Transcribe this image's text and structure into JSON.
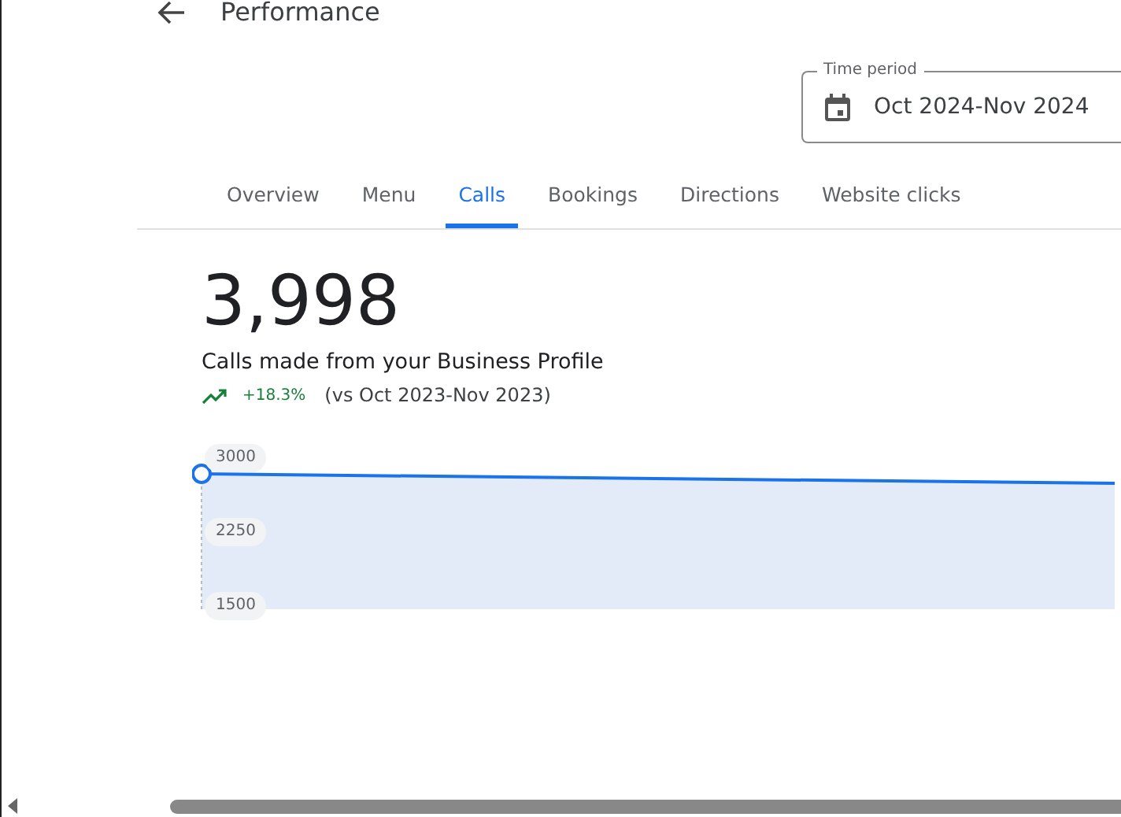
{
  "header": {
    "title": "Performance"
  },
  "time_period": {
    "label": "Time period",
    "value": "Oct 2024-Nov 2024"
  },
  "tabs": [
    {
      "label": "Overview",
      "selected": false
    },
    {
      "label": "Menu",
      "selected": false
    },
    {
      "label": "Calls",
      "selected": true
    },
    {
      "label": "Bookings",
      "selected": false
    },
    {
      "label": "Directions",
      "selected": false
    },
    {
      "label": "Website clicks",
      "selected": false
    }
  ],
  "metric": {
    "value": "3,998",
    "caption": "Calls made from your Business Profile",
    "change": "+18.3%",
    "comparison": "(vs Oct 2023-Nov 2023)"
  },
  "chart": {
    "y_labels": [
      "3000",
      "2250",
      "1500"
    ]
  }
}
